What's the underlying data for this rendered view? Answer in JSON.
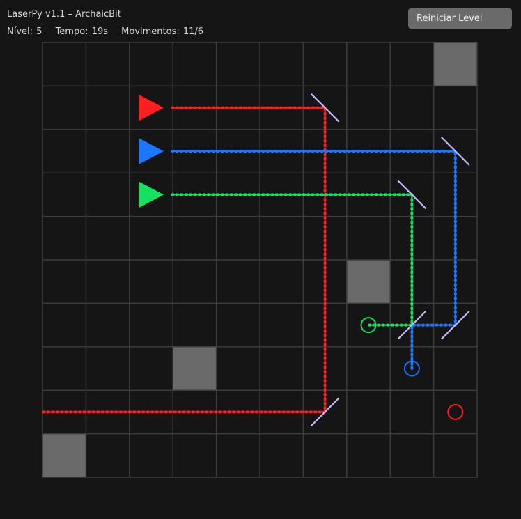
{
  "hud": {
    "title": "LaserPy v1.1 – ArchaicBit",
    "level_text": "Nível: 5",
    "time_text": "Tempo: 19s",
    "moves_text": "Movimentos: 11/6"
  },
  "controls": {
    "reset_label": "Reiniciar Level"
  },
  "board": {
    "rows": 10,
    "cols": 10,
    "blocks": [
      [
        0,
        9
      ],
      [
        5,
        7
      ],
      [
        7,
        3
      ],
      [
        9,
        0
      ]
    ],
    "emitters": [
      {
        "color": "red",
        "row": 1,
        "col": 2,
        "direction": "right"
      },
      {
        "color": "blue",
        "row": 2,
        "col": 2,
        "direction": "right"
      },
      {
        "color": "green",
        "row": 3,
        "col": 2,
        "direction": "right"
      }
    ],
    "mirrors": [
      {
        "row": 1,
        "col": 6,
        "orientation": "backslash"
      },
      {
        "row": 2,
        "col": 9,
        "orientation": "backslash"
      },
      {
        "row": 3,
        "col": 8,
        "orientation": "backslash"
      },
      {
        "row": 6,
        "col": 8,
        "orientation": "slash"
      },
      {
        "row": 6,
        "col": 9,
        "orientation": "slash"
      },
      {
        "row": 8,
        "col": 6,
        "orientation": "slash"
      }
    ],
    "targets": [
      {
        "color": "green",
        "row": 6,
        "col": 7
      },
      {
        "color": "blue",
        "row": 7,
        "col": 8
      },
      {
        "color": "red",
        "row": 8,
        "col": 9
      }
    ],
    "beams": [
      {
        "color": "red",
        "path": [
          [
            1,
            2
          ],
          [
            1,
            6
          ],
          [
            8,
            6
          ],
          [
            8,
            -0.5
          ]
        ]
      },
      {
        "color": "blue",
        "path": [
          [
            2,
            2
          ],
          [
            2,
            9
          ],
          [
            6,
            9
          ],
          [
            6,
            8
          ],
          [
            7,
            8
          ]
        ]
      },
      {
        "color": "green",
        "path": [
          [
            3,
            2
          ],
          [
            3,
            8
          ],
          [
            6,
            8
          ],
          [
            6,
            7
          ]
        ]
      }
    ]
  },
  "colors": {
    "background": "#151515",
    "grid_line": "#3c3c3c",
    "block": "#6a6a6a",
    "mirror": "#c4b8ff",
    "red": "#ff1f1f",
    "blue": "#1a78ff",
    "green": "#16e060",
    "button": "#6a6a6a"
  }
}
